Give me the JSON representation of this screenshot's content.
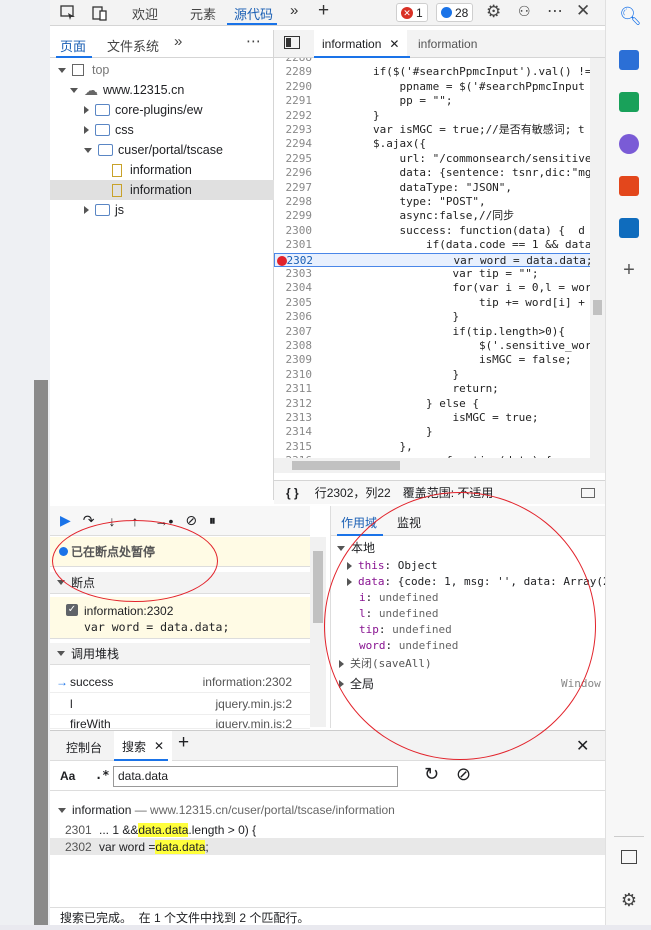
{
  "topbar": {
    "tabs": [
      "欢迎",
      "元素",
      "源代码"
    ],
    "errors": "1",
    "messages": "28"
  },
  "navigator": {
    "tabs": [
      "页面",
      "文件系统"
    ],
    "tree": [
      "top",
      "www.12315.cn",
      "core-plugins/ew",
      "css",
      "cuser/portal/tscase",
      "information",
      "information",
      "js"
    ]
  },
  "editor": {
    "tab_active": "information",
    "tab_inactive": "information",
    "lines": [
      {
        "n": "2288",
        "t": ""
      },
      {
        "n": "2289",
        "t": "        if($('#searchPpmcInput').val() !="
      },
      {
        "n": "2290",
        "t": "            ppname = $('#searchPpmcInput"
      },
      {
        "n": "2291",
        "t": "            pp = \"\";"
      },
      {
        "n": "2292",
        "t": "        }"
      },
      {
        "n": "2293",
        "t": "        var isMGC = true;//是否有敏感词; t"
      },
      {
        "n": "2294",
        "t": "        $.ajax({"
      },
      {
        "n": "2295",
        "t": "            url: \"/commonsearch/sensitive"
      },
      {
        "n": "2296",
        "t": "            data: {sentence: tsnr,dic:\"mg"
      },
      {
        "n": "2297",
        "t": "            dataType: \"JSON\","
      },
      {
        "n": "2298",
        "t": "            type: \"POST\","
      },
      {
        "n": "2299",
        "t": "            async:false,//同步"
      },
      {
        "n": "2300",
        "t": "            success: function(data) {  d"
      },
      {
        "n": "2301",
        "t": "                if(data.code == 1 && data"
      },
      {
        "n": "2302",
        "t": "                    var word = data.data;"
      },
      {
        "n": "2303",
        "t": "                    var tip = \"\";"
      },
      {
        "n": "2304",
        "t": "                    for(var i = 0,l = wor"
      },
      {
        "n": "2305",
        "t": "                        tip += word[i] +"
      },
      {
        "n": "2306",
        "t": "                    }"
      },
      {
        "n": "2307",
        "t": "                    if(tip.length>0){"
      },
      {
        "n": "2308",
        "t": "                        $('.sensitive_wor"
      },
      {
        "n": "2309",
        "t": "                        isMGC = false;"
      },
      {
        "n": "2310",
        "t": "                    }"
      },
      {
        "n": "2311",
        "t": "                    return;"
      },
      {
        "n": "2312",
        "t": "                } else {"
      },
      {
        "n": "2313",
        "t": "                    isMGC = true;"
      },
      {
        "n": "2314",
        "t": "                }"
      },
      {
        "n": "2315",
        "t": "            },"
      },
      {
        "n": "2316",
        "t": "            error: function(data) {"
      }
    ],
    "status_braces": "{ }",
    "status_position": "行2302，列22",
    "status_coverage": "覆盖范围: 不适用"
  },
  "debugger": {
    "paused": "已在断点处暂停",
    "breakpoints_title": "断点",
    "breakpoint_file": "information:2302",
    "breakpoint_code": "var word = data.data;",
    "callstack_title": "调用堆栈",
    "frames": [
      {
        "fn": "success",
        "loc": "information:2302"
      },
      {
        "fn": "l",
        "loc": "jquery.min.js:2"
      },
      {
        "fn": "fireWith",
        "loc": "jquery.min.js:2"
      }
    ]
  },
  "scope": {
    "tabs": [
      "作用域",
      "监视"
    ],
    "local": "本地",
    "lines": [
      {
        "k": "this",
        "v": "Object"
      },
      {
        "k": "data",
        "v": "{code: 1, msg: '', data: Array(2"
      },
      {
        "k": "i",
        "v": "undefined"
      },
      {
        "k": "l",
        "v": "undefined"
      },
      {
        "k": "tip",
        "v": "undefined"
      },
      {
        "k": "word",
        "v": "undefined"
      }
    ],
    "closure": "关闭(saveAll)",
    "global": "全局",
    "global_val": "Window"
  },
  "drawer": {
    "tabs": [
      "控制台",
      "搜索"
    ],
    "aa": "Aa",
    "regex": ".*",
    "query": "data.data",
    "result_file": "information",
    "result_path": "— www.12315.cn/cuser/portal/tscase/information",
    "r1_line": "2301",
    "r1_pre": "... 1 && ",
    "r1_hl": "data.data",
    "r1_post": ".length > 0) {",
    "r2_line": "2302",
    "r2_pre": "var word = ",
    "r2_hl": "data.data",
    "r2_post": ";",
    "status": "搜索已完成。  在 1 个文件中找到 2 个匹配行。"
  }
}
